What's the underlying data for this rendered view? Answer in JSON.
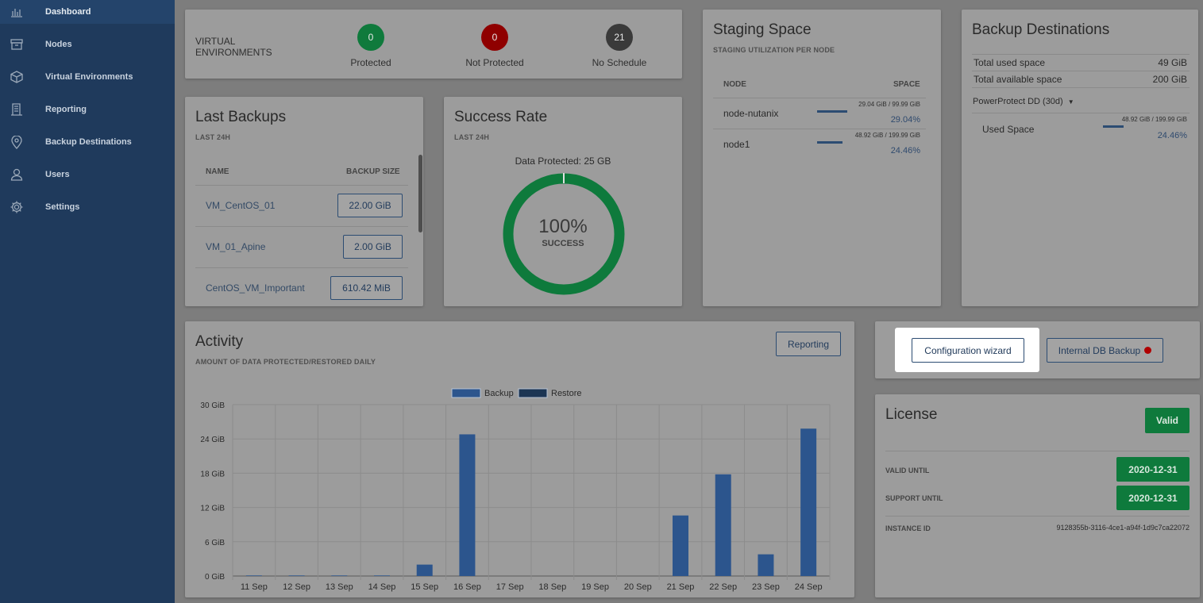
{
  "sidebar": {
    "items": [
      {
        "label": "Dashboard",
        "icon": "bar-chart-icon"
      },
      {
        "label": "Nodes",
        "icon": "archive-box-icon"
      },
      {
        "label": "Virtual Environments",
        "icon": "cube-icon"
      },
      {
        "label": "Reporting",
        "icon": "report-icon"
      },
      {
        "label": "Backup Destinations",
        "icon": "map-pin-icon"
      },
      {
        "label": "Users",
        "icon": "user-icon"
      },
      {
        "label": "Settings",
        "icon": "gear-icon"
      }
    ]
  },
  "virtual_environments": {
    "label_line1": "VIRTUAL",
    "label_line2": "ENVIRONMENTS",
    "stats": [
      {
        "value": "0",
        "label": "Protected",
        "color": "#0f7a3c"
      },
      {
        "value": "0",
        "label": "Not Protected",
        "color": "#8f0000"
      },
      {
        "value": "21",
        "label": "No Schedule",
        "color": "#3a3a3a"
      }
    ]
  },
  "last_backups": {
    "title": "Last Backups",
    "subtitle": "LAST 24H",
    "col_name": "NAME",
    "col_size": "BACKUP SIZE",
    "rows": [
      {
        "name": "VM_CentOS_01",
        "size": "22.00 GiB"
      },
      {
        "name": "VM_01_Apine",
        "size": "2.00 GiB"
      },
      {
        "name": "CentOS_VM_Important",
        "size": "610.42 MiB"
      }
    ]
  },
  "success_rate": {
    "title": "Success Rate",
    "subtitle": "LAST 24H",
    "data_protected": "Data Protected: 25 GB",
    "percent": "100%",
    "percent_value": 1.0,
    "status": "SUCCESS",
    "color": "#0e7a3c"
  },
  "staging": {
    "title": "Staging Space",
    "subtitle": "STAGING UTILIZATION PER NODE",
    "col_node": "NODE",
    "col_space": "SPACE",
    "nodes": [
      {
        "name": "node-nutanix",
        "usage": "29.04 GiB / 99.99 GiB",
        "percent": "29.04%",
        "fraction": 0.2904
      },
      {
        "name": "node1",
        "usage": "48.92 GiB / 199.99 GiB",
        "percent": "24.46%",
        "fraction": 0.2446
      }
    ]
  },
  "backup_destinations": {
    "title": "Backup Destinations",
    "total_used_label": "Total used space",
    "total_used_value": "49 GiB",
    "total_available_label": "Total available space",
    "total_available_value": "200 GiB",
    "dropdown": "PowerProtect DD (30d)",
    "used_space_label": "Used Space",
    "used_space_usage": "48.92 GiB / 199.99 GiB",
    "used_space_percent": "24.46%",
    "used_space_fraction": 0.2446
  },
  "actions": {
    "configuration_wizard": "Configuration wizard",
    "internal_db_backup": "Internal DB Backup"
  },
  "license": {
    "title": "License",
    "status": "Valid",
    "valid_until_label": "VALID UNTIL",
    "valid_until_value": "2020-12-31",
    "support_until_label": "SUPPORT UNTIL",
    "support_until_value": "2020-12-31",
    "instance_id_label": "INSTANCE ID",
    "instance_id_value": "9128355b-3116-4ce1-a94f-1d9c7ca22072"
  },
  "activity": {
    "title": "Activity",
    "subtitle": "AMOUNT OF DATA PROTECTED/RESTORED DAILY",
    "reporting_button": "Reporting"
  },
  "chart_data": {
    "type": "bar",
    "categories": [
      "11 Sep",
      "12 Sep",
      "13 Sep",
      "14 Sep",
      "15 Sep",
      "16 Sep",
      "17 Sep",
      "18 Sep",
      "19 Sep",
      "20 Sep",
      "21 Sep",
      "22 Sep",
      "23 Sep",
      "24 Sep"
    ],
    "series": [
      {
        "name": "Backup",
        "color": "#2c558d",
        "values": [
          0.1,
          0.1,
          0.1,
          0.1,
          2,
          24.8,
          0,
          0,
          0,
          0,
          10.6,
          17.8,
          3.8,
          25.8
        ]
      },
      {
        "name": "Restore",
        "color": "#1c3553",
        "values": [
          0,
          0,
          0,
          0,
          0,
          0,
          0,
          0,
          0,
          0,
          0,
          0,
          0,
          0
        ]
      }
    ],
    "y_ticks": [
      "0 GiB",
      "6 GiB",
      "12 GiB",
      "18 GiB",
      "24 GiB",
      "30 GiB"
    ],
    "ylim": [
      0,
      30
    ],
    "grid": true,
    "legend": "top-center"
  }
}
